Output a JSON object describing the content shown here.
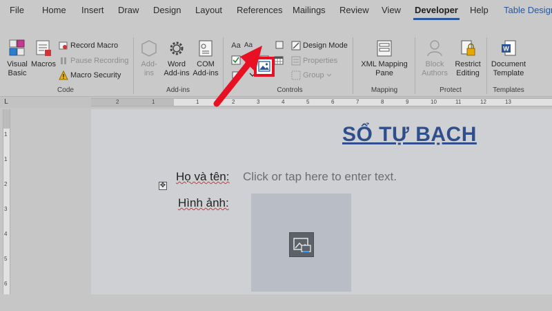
{
  "tabs": [
    {
      "label": "File"
    },
    {
      "label": "Home"
    },
    {
      "label": "Insert"
    },
    {
      "label": "Draw"
    },
    {
      "label": "Design"
    },
    {
      "label": "Layout"
    },
    {
      "label": "References"
    },
    {
      "label": "Mailings"
    },
    {
      "label": "Review"
    },
    {
      "label": "View"
    },
    {
      "label": "Developer",
      "active": true
    },
    {
      "label": "Help"
    },
    {
      "label": "Table Design"
    }
  ],
  "ribbon": {
    "code": {
      "label": "Code",
      "visual_basic": "Visual Basic",
      "macros": "Macros",
      "record_macro": "Record Macro",
      "pause_recording": "Pause Recording",
      "macro_security": "Macro Security"
    },
    "addins": {
      "label": "Add-ins",
      "addins_btn": "Add- ins",
      "word_addins": "Word Add-ins",
      "com_addins": "COM Add-ins"
    },
    "controls": {
      "label": "Controls",
      "rich_text_glyph": "Aa",
      "plain_text_glyph": "Aa",
      "design_mode": "Design Mode",
      "properties": "Properties",
      "group": "Group"
    },
    "mapping": {
      "label": "Mapping",
      "xml_pane": "XML Mapping Pane"
    },
    "protect": {
      "label": "Protect",
      "block_authors": "Block Authors",
      "restrict_editing": "Restrict Editing"
    },
    "templates": {
      "label": "Templates",
      "document_template": "Document Template"
    }
  },
  "ruler": {
    "corner": "L",
    "h_numbers": [
      "2",
      "1",
      "1",
      "2",
      "3",
      "4",
      "5",
      "6",
      "7",
      "8",
      "9",
      "10",
      "11",
      "12",
      "13"
    ],
    "v_numbers": [
      "1",
      "1",
      "2",
      "3",
      "4",
      "5",
      "6"
    ]
  },
  "document": {
    "title": "SỔ TỰ BẠCH",
    "name_label": "Họ và tên:",
    "name_placeholder": "Click or tap here to enter text.",
    "image_label": "Hình ảnh:"
  },
  "colors": {
    "accent": "#2b579a",
    "highlight": "#e81123",
    "title": "#2f4f8a"
  }
}
